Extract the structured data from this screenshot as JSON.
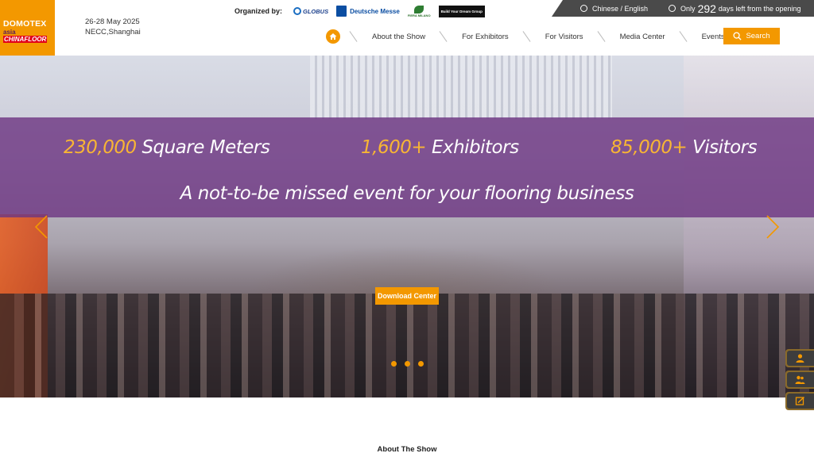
{
  "logo": {
    "line1": "DOMOTEX",
    "line2a": "asia",
    "line2b": "CHINAFLOOR"
  },
  "event": {
    "dates": "26-28 May 2025",
    "venue": "NECC,Shanghai"
  },
  "organizers": {
    "label": "Organized by:",
    "items": [
      "GLOBUS",
      "Deutsche Messe",
      "FIERA MILANO",
      "Build Your Dream Group"
    ]
  },
  "topbar": {
    "language": "Chinese / English",
    "countdown_prefix": "Only",
    "countdown_days": "292",
    "countdown_suffix": "days left from the opening"
  },
  "nav": {
    "items": [
      "About the Show",
      "For Exhibitors",
      "For Visitors",
      "Media Center",
      "Events"
    ],
    "search_label": "Search"
  },
  "hero": {
    "stats": [
      {
        "number": "230,000",
        "label": "Square Meters"
      },
      {
        "number": "1,600+",
        "label": "Exhibitors"
      },
      {
        "number": "85,000+",
        "label": "Visitors"
      }
    ],
    "tagline": "A not-to-be missed event for your flooring business",
    "download_label": "Download Center",
    "slide_count": 3
  },
  "sections": {
    "about_title": "About The Show"
  },
  "colors": {
    "accent": "#f39800",
    "banner": "#6e3782",
    "topbar": "#4a4a4a",
    "stat_number": "#f8b534"
  }
}
